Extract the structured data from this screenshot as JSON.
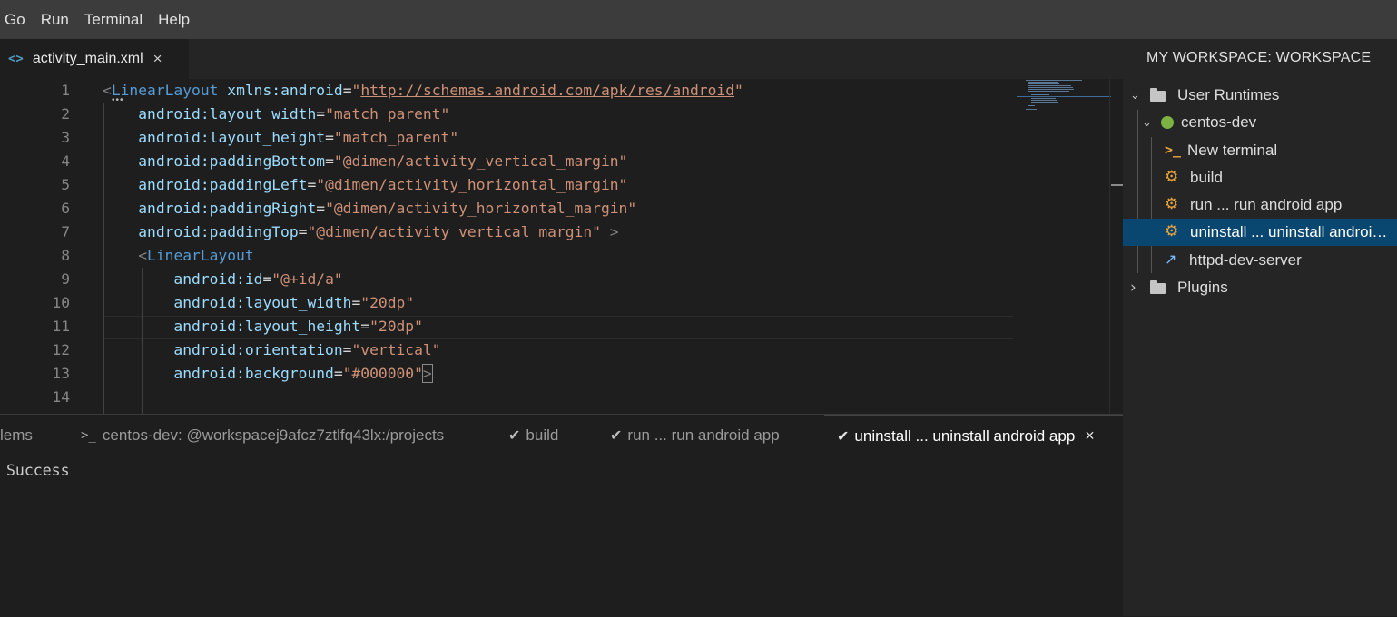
{
  "menu": [
    "Go",
    "Run",
    "Terminal",
    "Help"
  ],
  "editor_tab": {
    "filename": "activity_main.xml",
    "icon": "code-brackets-icon",
    "close": "×"
  },
  "code_lines": [
    {
      "n": "1",
      "tokens": [
        [
          "punc",
          "<"
        ],
        [
          "tag",
          "LinearLayout"
        ],
        [
          "eq",
          " "
        ],
        [
          "attr",
          "xmlns:android"
        ],
        [
          "eq",
          "="
        ],
        [
          "str",
          "\""
        ],
        [
          "strurl",
          "http://schemas.android.com/apk/res/android"
        ],
        [
          "str",
          "\""
        ]
      ]
    },
    {
      "n": "2",
      "tokens": [
        [
          "eq",
          "    "
        ],
        [
          "attr",
          "android:layout_width"
        ],
        [
          "eq",
          "="
        ],
        [
          "str",
          "\"match_parent\""
        ]
      ]
    },
    {
      "n": "3",
      "tokens": [
        [
          "eq",
          "    "
        ],
        [
          "attr",
          "android:layout_height"
        ],
        [
          "eq",
          "="
        ],
        [
          "str",
          "\"match_parent\""
        ]
      ]
    },
    {
      "n": "4",
      "tokens": [
        [
          "eq",
          "    "
        ],
        [
          "attr",
          "android:paddingBottom"
        ],
        [
          "eq",
          "="
        ],
        [
          "str",
          "\"@dimen/activity_vertical_margin\""
        ]
      ]
    },
    {
      "n": "5",
      "tokens": [
        [
          "eq",
          "    "
        ],
        [
          "attr",
          "android:paddingLeft"
        ],
        [
          "eq",
          "="
        ],
        [
          "str",
          "\"@dimen/activity_horizontal_margin\""
        ]
      ]
    },
    {
      "n": "6",
      "tokens": [
        [
          "eq",
          "    "
        ],
        [
          "attr",
          "android:paddingRight"
        ],
        [
          "eq",
          "="
        ],
        [
          "str",
          "\"@dimen/activity_horizontal_margin\""
        ]
      ]
    },
    {
      "n": "7",
      "tokens": [
        [
          "eq",
          "    "
        ],
        [
          "attr",
          "android:paddingTop"
        ],
        [
          "eq",
          "="
        ],
        [
          "str",
          "\"@dimen/activity_vertical_margin\""
        ],
        [
          "eq",
          " "
        ],
        [
          "punc",
          ">"
        ]
      ]
    },
    {
      "n": "8",
      "tokens": [
        [
          "eq",
          "    "
        ],
        [
          "punc",
          "<"
        ],
        [
          "tag",
          "LinearLayout"
        ]
      ]
    },
    {
      "n": "9",
      "tokens": [
        [
          "eq",
          "        "
        ],
        [
          "attr",
          "android:id"
        ],
        [
          "eq",
          "="
        ],
        [
          "str",
          "\"@+id/a\""
        ]
      ]
    },
    {
      "n": "10",
      "tokens": [
        [
          "eq",
          "        "
        ],
        [
          "attr",
          "android:layout_width"
        ],
        [
          "eq",
          "="
        ],
        [
          "str",
          "\"20dp\""
        ]
      ]
    },
    {
      "n": "11",
      "tokens": [
        [
          "eq",
          "        "
        ],
        [
          "attr",
          "android:layout_height"
        ],
        [
          "eq",
          "="
        ],
        [
          "str",
          "\"20dp\""
        ]
      ]
    },
    {
      "n": "12",
      "tokens": [
        [
          "eq",
          "        "
        ],
        [
          "attr",
          "android:orientation"
        ],
        [
          "eq",
          "="
        ],
        [
          "str",
          "\"vertical\""
        ]
      ]
    },
    {
      "n": "13",
      "tokens": [
        [
          "eq",
          "        "
        ],
        [
          "attr",
          "android:background"
        ],
        [
          "eq",
          "="
        ],
        [
          "str",
          "\"#000000\""
        ],
        [
          "box",
          ">"
        ]
      ]
    },
    {
      "n": "14",
      "tokens": []
    }
  ],
  "panel": {
    "tabs": [
      {
        "label": "lems",
        "kind": "plain"
      },
      {
        "label": "centos-dev: @workspacej9afcz7ztlfq43lx:/projects",
        "kind": "terminal",
        "prompt": ">_"
      },
      {
        "label": "build",
        "kind": "task",
        "check": "✔"
      },
      {
        "label": "run ... run android app",
        "kind": "task",
        "check": "✔"
      },
      {
        "label": "uninstall ... uninstall android app",
        "kind": "task-active",
        "check": "✔",
        "close": "×"
      }
    ],
    "output": "Success"
  },
  "sidebar": {
    "title": "MY WORKSPACE: WORKSPACE",
    "tree": {
      "user_runtimes": "User Runtimes",
      "centos_dev": "centos-dev",
      "new_terminal": "New terminal",
      "build": "build",
      "run": "run ... run android app",
      "uninstall": "uninstall ... uninstall android app",
      "httpd": "httpd-dev-server",
      "plugins": "Plugins",
      "term_prompt": ">_"
    }
  },
  "colors": {
    "accent_selected": "#094771",
    "status_green": "#7cb342",
    "task_orange": "#e8a33d"
  }
}
